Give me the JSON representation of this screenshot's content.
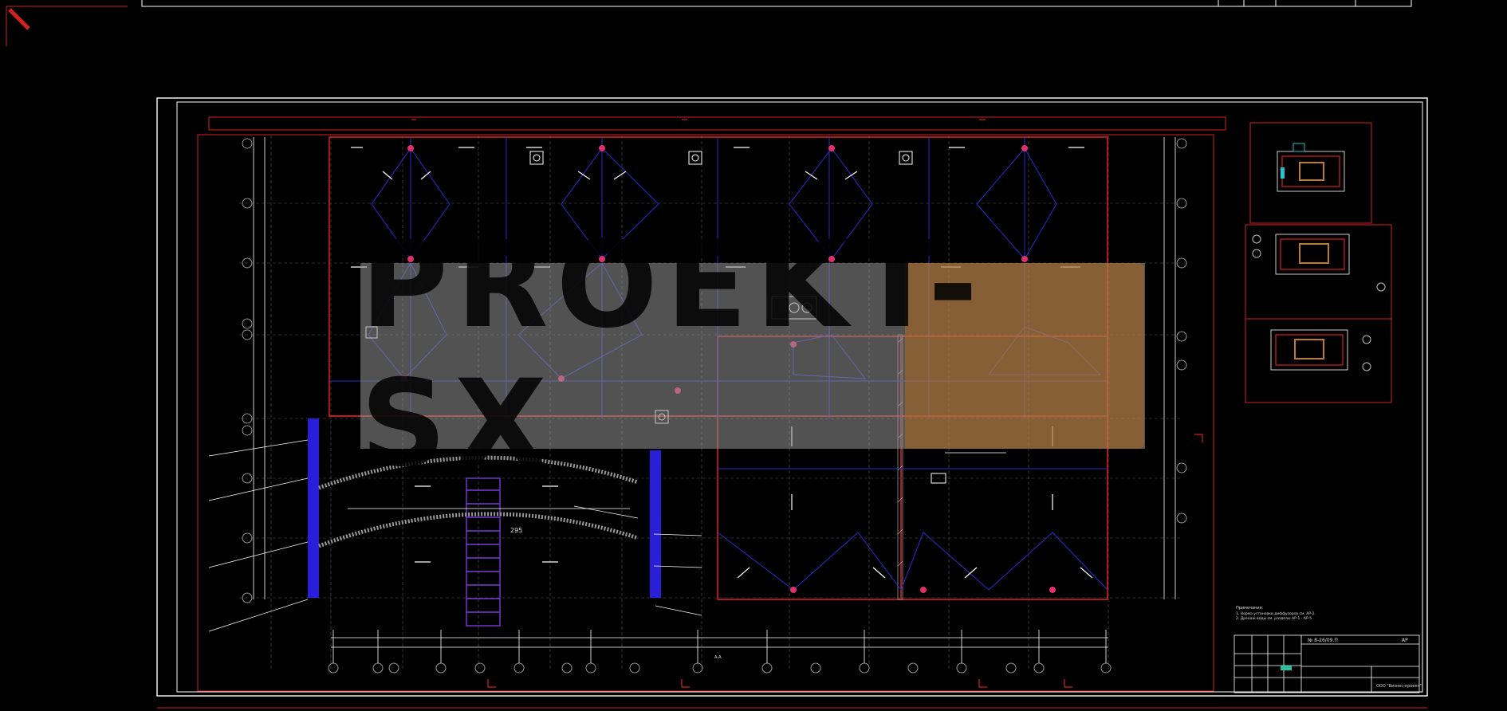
{
  "watermark": {
    "text": "PROEKT-SX"
  },
  "colors": {
    "background": "#000000",
    "frame": "#ffffff",
    "red": "#d22020",
    "blue": "#2a2ad0",
    "duct_fill": "#2a1fd8",
    "watermark_gray": "#8c8c8c",
    "watermark_orange": "#c86e14",
    "diffuser_pink": "#e0306a"
  },
  "drawing": {
    "type": "ventilation floor plan (AutoCAD model space)",
    "stamp_code": "АР",
    "stair_label": "295",
    "center_tag": "А-А"
  },
  "title_block": {
    "code": "№ 8-26/09.П",
    "sheet_mark": "АР",
    "company": "ООО \"Бизнес-проект\""
  },
  "notes": {
    "header": "Примечания:",
    "line1": "1. Норма установки диффузоров см. АР-2.",
    "line2": "2. Дренаж воды см. разделы АР-1 - АР-5"
  }
}
